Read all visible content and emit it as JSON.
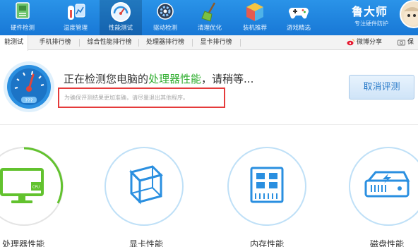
{
  "toolbar": {
    "items": [
      {
        "label": "硬件检测",
        "icon": "hardware-board-icon"
      },
      {
        "label": "温度管理",
        "icon": "thermometer-icon"
      },
      {
        "label": "性能测试",
        "icon": "speedometer-icon",
        "active": true
      },
      {
        "label": "驱动检测",
        "icon": "gear-driver-icon"
      },
      {
        "label": "清理优化",
        "icon": "broom-icon"
      },
      {
        "label": "装机推荐",
        "icon": "cube-icon"
      },
      {
        "label": "游戏精选",
        "icon": "gamepad-icon"
      }
    ],
    "brand_name": "鲁大师",
    "brand_slogan": "专注硬件防护"
  },
  "tabs": {
    "items": [
      {
        "label": "能测试",
        "active": true
      },
      {
        "label": "手机排行榜"
      },
      {
        "label": "综合性能排行榜"
      },
      {
        "label": "处理器排行榜"
      },
      {
        "label": "显卡排行榜"
      }
    ],
    "weibo_share": "微博分享",
    "more": "保"
  },
  "status": {
    "title_prefix": "正在检测您电脑的",
    "title_highlight": "处理器性能",
    "title_suffix": "，请稍等...",
    "hint": "为确保评测结果更加准确，请尽量退出其他程序。",
    "cancel_label": "取消评测"
  },
  "cards": [
    {
      "label": "处理器性能",
      "icon": "cpu-monitor-icon",
      "state": "testing"
    },
    {
      "label": "显卡性能",
      "icon": "graphics-cube-icon"
    },
    {
      "label": "内存性能",
      "icon": "memory-chip-icon"
    },
    {
      "label": "磁盘性能",
      "icon": "disk-drive-icon"
    }
  ],
  "colors": {
    "toolbar": "#1f86df",
    "highlight": "#2fae2f",
    "accent": "#2a8fe0",
    "hint_border": "#e53b3b"
  }
}
